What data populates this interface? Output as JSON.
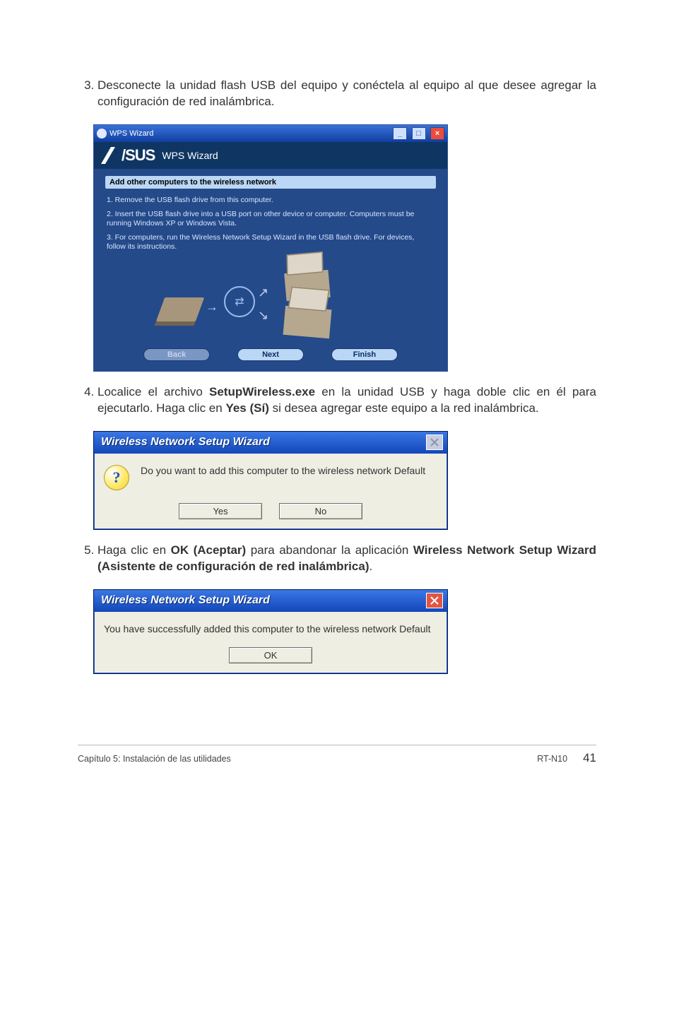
{
  "steps": {
    "start": 3,
    "s3": "Desconecte la unidad flash USB del equipo y conéctela al equipo al que desee agregar la configuración de red inalámbrica.",
    "s4_a": "Localice el archivo ",
    "s4_b": "SetupWireless.exe",
    "s4_c": " en la unidad USB y haga doble clic en él para ejecutarlo. Haga clic en ",
    "s4_d": "Yes (Sí)",
    "s4_e": " si desea agregar este equipo a la red inalámbrica.",
    "s5_a": "Haga clic en ",
    "s5_b": "OK (Aceptar)",
    "s5_c": " para abandonar la aplicación ",
    "s5_d": "Wireless Network Setup Wizard (Asistente de configuración de red inalámbrica)",
    "s5_e": "."
  },
  "wps": {
    "titlebar": "WPS Wizard",
    "brand": "/SUS",
    "header_title": "WPS Wizard",
    "subtitle": "Add other computers to the wireless network",
    "line1": "1. Remove the USB flash drive from this computer.",
    "line2": "2. Insert the USB flash drive into a USB port on other device or computer. Computers must be running Windows XP or Windows Vista.",
    "line3": "3. For computers, run the Wireless Network Setup Wizard in the USB flash drive. For devices, follow its instructions.",
    "btn_back": "Back",
    "btn_next": "Next",
    "btn_finish": "Finish",
    "usb_glyph": "⇄"
  },
  "dlg1": {
    "title": "Wireless Network Setup Wizard",
    "text": "Do you want to add this computer to the wireless network Default",
    "yes": "Yes",
    "no": "No"
  },
  "dlg2": {
    "title": "Wireless Network Setup Wizard",
    "text": "You have successfully added this computer to the wireless network Default",
    "ok": "OK"
  },
  "footer": {
    "left": "Capítulo 5: Instalación de las utilidades",
    "model": "RT-N10",
    "page": "41"
  }
}
